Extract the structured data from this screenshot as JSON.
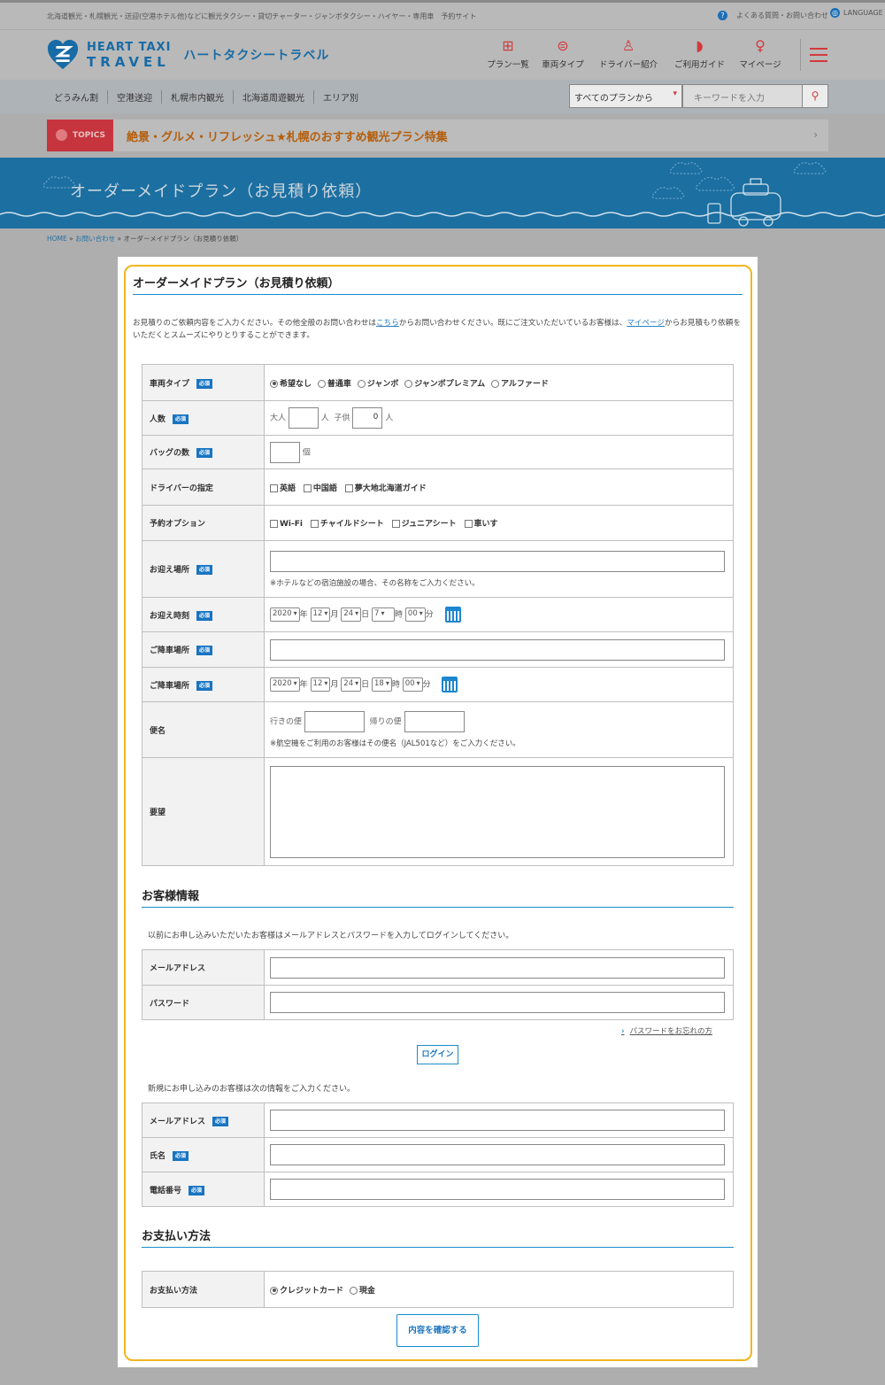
{
  "top": {
    "tagline": "北海道観光・札幌観光・送迎(空港ホテル他)などに観光タクシー・貸切チャーター・ジャンボタクシー・ハイヤー・専用車　予約サイト",
    "faq": "よくある質問・お問い合わせ",
    "language": "LANGUAGE"
  },
  "logo": {
    "line1": "HEART TAXI",
    "line2": "TRAVEL",
    "jp": "ハートタクシートラベル"
  },
  "nav": [
    "プラン一覧",
    "車両タイプ",
    "ドライバー紹介",
    "ご利用ガイド",
    "マイページ"
  ],
  "subnav": [
    "どうみん割",
    "空港送迎",
    "札幌市内観光",
    "北海道周遊観光",
    "エリア別"
  ],
  "search": {
    "select": "すべてのプランから",
    "placeholder": "キーワードを入力"
  },
  "topics": {
    "label": "TOPICS",
    "text": "絶景・グルメ・リフレッシュ★札幌のおすすめ観光プラン特集",
    "arrow": "›"
  },
  "page_title": "オーダーメイドプラン（お見積り依頼）",
  "breadcrumb": {
    "home": "HOME",
    "sep": "»",
    "contact": "お問い合わせ",
    "current": "オーダーメイドプラン（お見積り依頼）"
  },
  "form_title": "オーダーメイドプラン（お見積り依頼）",
  "intro": {
    "a": "お見積りのご依頼内容をご入力ください。その他全般のお問い合わせは",
    "link1": "こちら",
    "b": "からお問い合わせください。既にご注文いただいているお客様は、",
    "link2": "マイページ",
    "c": "からお見積もり依頼をいただくとスムーズにやりとりすることができます。"
  },
  "required": "必須",
  "fields": {
    "vehicle": {
      "label": "車両タイプ",
      "options": [
        "希望なし",
        "普通車",
        "ジャンボ",
        "ジャンボプレミアム",
        "アルファード"
      ],
      "selected": 0
    },
    "people": {
      "label": "人数",
      "adult": "大人",
      "unit": "人",
      "child": "子供",
      "child_value": "0"
    },
    "bags": {
      "label": "バッグの数",
      "unit": "個"
    },
    "driver": {
      "label": "ドライバーの指定",
      "options": [
        "英語",
        "中国語",
        "夢大地北海道ガイド"
      ]
    },
    "options": {
      "label": "予約オプション",
      "options": [
        "Wi-Fi",
        "チャイルドシート",
        "ジュニアシート",
        "車いす"
      ]
    },
    "pickup": {
      "label": "お迎え場所",
      "note": "※ホテルなどの宿泊施設の場合、その名称をご入力ください。"
    },
    "pickup_time": {
      "label": "お迎え時刻",
      "year": "2020",
      "month": "12",
      "day": "24",
      "hour": "7",
      "min": "00"
    },
    "dropoff": {
      "label": "ご降車場所"
    },
    "dropoff_time": {
      "label": "ご降車場所",
      "year": "2020",
      "month": "12",
      "day": "24",
      "hour": "18",
      "min": "00"
    },
    "flight": {
      "label": "便名",
      "out": "行きの便",
      "ret": "帰りの便",
      "note": "※航空機をご利用のお客様はその便名（JAL501など）をご入力ください。"
    },
    "request": {
      "label": "要望"
    }
  },
  "units": {
    "year": "年",
    "month": "月",
    "day": "日",
    "hour": "時",
    "min": "分"
  },
  "customer": {
    "title": "お客様情報",
    "login_text": "以前にお申し込みいただいたお客様はメールアドレスとパスワードを入力してログインしてください。",
    "email": "メールアドレス",
    "password": "パスワード",
    "forgot": "パスワードをお忘れの方",
    "login": "ログイン",
    "new_text": "新規にお申し込みのお客様は次の情報をご入力ください。",
    "new_email": "メールアドレス",
    "name": "氏名",
    "phone": "電話番号"
  },
  "payment": {
    "title": "お支払い方法",
    "label": "お支払い方法",
    "options": [
      "クレジットカード",
      "現金"
    ],
    "selected": 0
  },
  "confirm": "内容を確認する",
  "colors": {
    "accent": "#1c8ccd",
    "border": "#f0b61e",
    "brand": "#176ba6",
    "nav_icon": "#d23a3e"
  }
}
